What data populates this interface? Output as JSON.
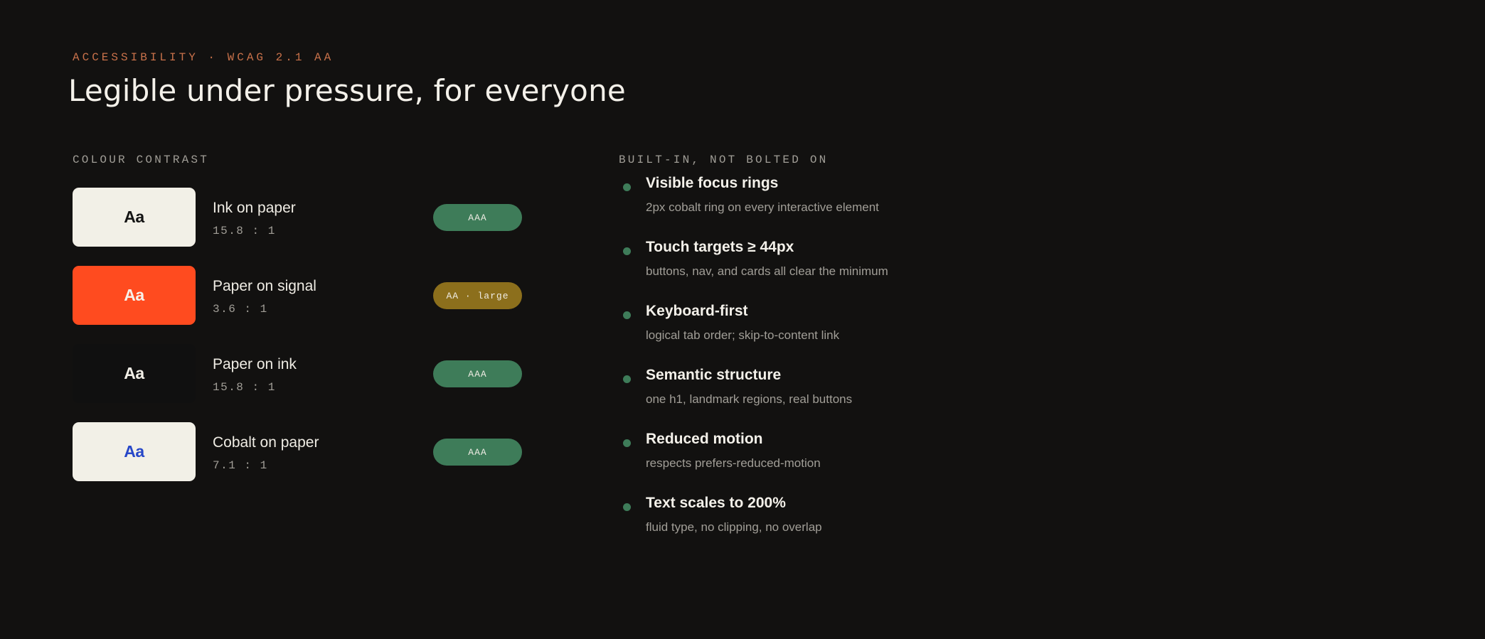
{
  "header": {
    "eyebrow": "ACCESSIBILITY · WCAG 2.1 AA",
    "title": "Legible under pressure, for everyone"
  },
  "contrast": {
    "label": "COLOUR CONTRAST",
    "rows": [
      {
        "sample": "Aa",
        "name": "Ink on paper",
        "ratio": "15.8 : 1",
        "badge": "AAA",
        "bg": "#f2f0e7",
        "fg": "#141414"
      },
      {
        "sample": "Aa",
        "name": "Paper on signal",
        "ratio": "3.6 : 1",
        "badge": "AA · large",
        "bg": "#ff4b1f",
        "fg": "#f7f1ea"
      },
      {
        "sample": "Aa",
        "name": "Paper on ink",
        "ratio": "15.8 : 1",
        "badge": "AAA",
        "bg": "#101010",
        "fg": "#f2efe7"
      },
      {
        "sample": "Aa",
        "name": "Cobalt on paper",
        "ratio": "7.1 : 1",
        "badge": "AAA",
        "bg": "#f2f0e7",
        "fg": "#2747c8"
      }
    ]
  },
  "features": {
    "label": "BUILT-IN, NOT BOLTED ON",
    "items": [
      {
        "title": "Visible focus rings",
        "desc": "2px cobalt ring on every interactive element"
      },
      {
        "title": "Touch targets ≥ 44px",
        "desc": "buttons, nav, and cards all clear the minimum"
      },
      {
        "title": "Keyboard-first",
        "desc": "logical tab order; skip-to-content link"
      },
      {
        "title": "Semantic structure",
        "desc": "one h1, landmark regions, real buttons"
      },
      {
        "title": "Reduced motion",
        "desc": "respects prefers-reduced-motion"
      },
      {
        "title": "Text scales to 200%",
        "desc": "fluid type, no clipping, no overlap"
      }
    ]
  },
  "colors": {
    "background": "#121110",
    "accent_eyebrow": "#c8714a",
    "badge_aaa": "#3e7c59",
    "badge_aa_large": "#8c6f1c",
    "bullet": "#3e7c59"
  }
}
